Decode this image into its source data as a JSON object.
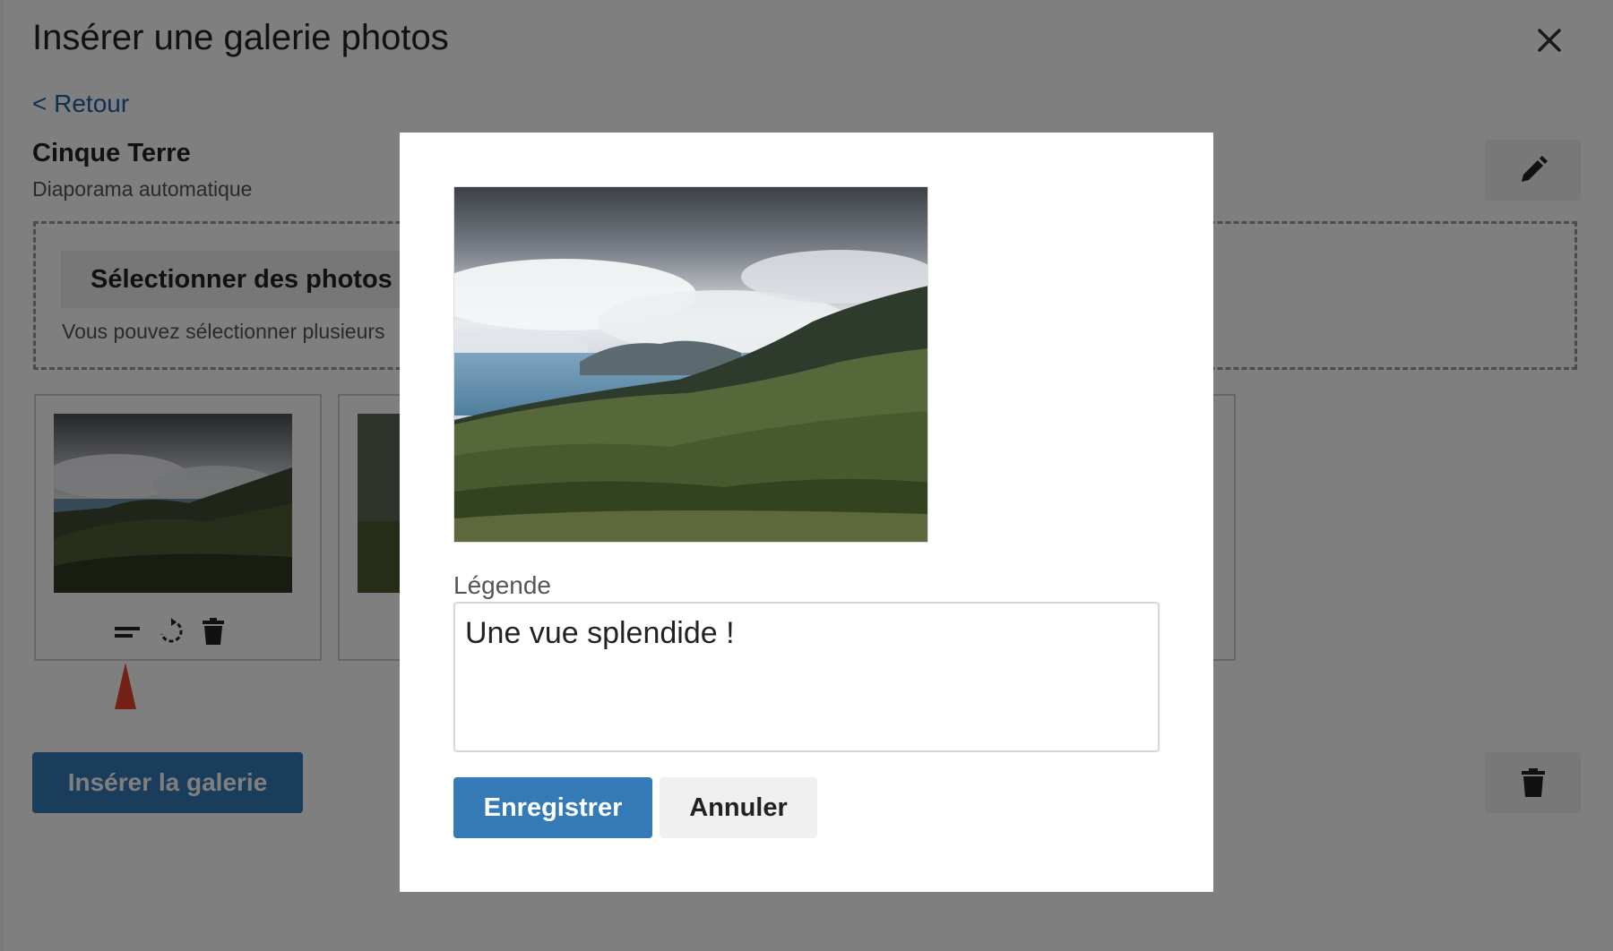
{
  "dialog": {
    "title": "Insérer une galerie photos",
    "close_icon": "close-icon",
    "back_label": "< Retour",
    "gallery_name": "Cinque Terre",
    "gallery_mode": "Diaporama automatique",
    "edit_icon": "pencil-icon",
    "select_photos_label": "Sélectionner des photos",
    "select_photos_help": "Vous pouvez sélectionner plusieurs",
    "tile_actions": [
      "caption-icon",
      "rotate-icon",
      "trash-icon"
    ],
    "insert_label": "Insérer la galerie",
    "delete_icon": "trash-icon"
  },
  "modal": {
    "caption_label": "Légende",
    "caption_value": "Une vue splendide !",
    "save_label": "Enregistrer",
    "cancel_label": "Annuler"
  },
  "colors": {
    "primary": "#337ab7",
    "link": "#1f5fa8",
    "marker": "#e8452c",
    "backdrop": "rgba(0,0,0,0.5)"
  }
}
